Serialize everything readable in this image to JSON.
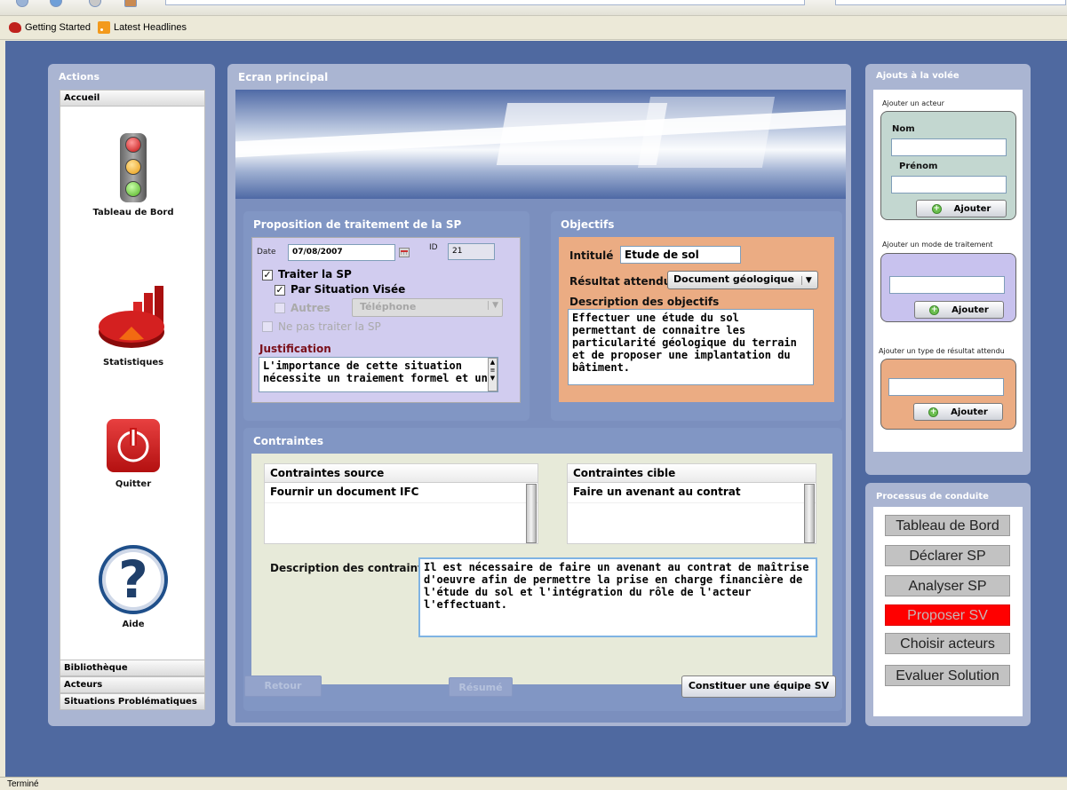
{
  "bookmarks": {
    "getting_started": "Getting Started",
    "latest_headlines": "Latest Headlines"
  },
  "status_bar": {
    "text": "Terminé"
  },
  "left_panel": {
    "title": "Actions",
    "accordion_open": "Accueil",
    "nav_items": [
      "Tableau de Bord",
      "Statistiques",
      "Quitter",
      "Aide"
    ],
    "accordion_closed": [
      "Bibliothèque",
      "Acteurs",
      "Situations Problématiques"
    ]
  },
  "main": {
    "title": "Ecran principal",
    "proposition": {
      "title": "Proposition de traitement de la SP",
      "date_label": "Date",
      "date_value": "07/08/2007",
      "id_label": "ID",
      "id_value": "21",
      "traiter_label": "Traiter la SP",
      "traiter_checked": true,
      "par_situation_label": "Par Situation Visée",
      "par_situation_checked": true,
      "autres_label": "Autres",
      "autres_select": "Téléphone",
      "ne_pas_traiter_label": "Ne pas traiter la SP",
      "justification_label": "Justification",
      "justification_text": "L'importance de cette situation nécessite un traiement formel et un"
    },
    "objectifs": {
      "title": "Objectifs",
      "intitule_label": "Intitulé",
      "intitule_value": "Etude de sol",
      "resultat_label": "Résultat attendu",
      "resultat_value": "Document géologique",
      "description_label": "Description des objectifs",
      "description_text": "Effectuer une étude du sol permettant de connaitre les particularité géologique du terrain et de proposer une implantation du bâtiment."
    },
    "contraintes": {
      "title": "Contraintes",
      "source_header": "Contraintes source",
      "source_rows": [
        "Fournir un document IFC"
      ],
      "cible_header": "Contraintes cible",
      "cible_rows": [
        "Faire un avenant au contrat"
      ],
      "description_label": "Description des contraintes",
      "description_text": "Il est nécessaire de faire un avenant au contrat de maîtrise d'oeuvre afin de permettre la prise en charge financière de l'étude du sol et l'intégration du rôle de l'acteur l'effectuant."
    },
    "buttons": {
      "retour": "Retour",
      "resume": "Résumé",
      "constituer": "Constituer une équipe SV"
    }
  },
  "right_panel": {
    "title": "Ajouts à la volée",
    "acteur_label": "Ajouter un acteur",
    "nom_label": "Nom",
    "prenom_label": "Prénom",
    "mode_label": "Ajouter un mode de traitement",
    "type_label": "Ajouter un type de résultat attendu",
    "ajouter_button": "Ajouter",
    "colors": {
      "acteur_box": "#c3d7d0",
      "mode_box": "#c8c2ee",
      "type_box": "#ebac83"
    }
  },
  "process_panel": {
    "title": "Processus de conduite",
    "steps": [
      "Tableau de Bord",
      "Déclarer SP",
      "Analyser SP",
      "Proposer SV",
      "Choisir acteurs",
      "Evaluer Solution"
    ],
    "active_step": "Proposer SV",
    "active_color": "#ff0000"
  }
}
